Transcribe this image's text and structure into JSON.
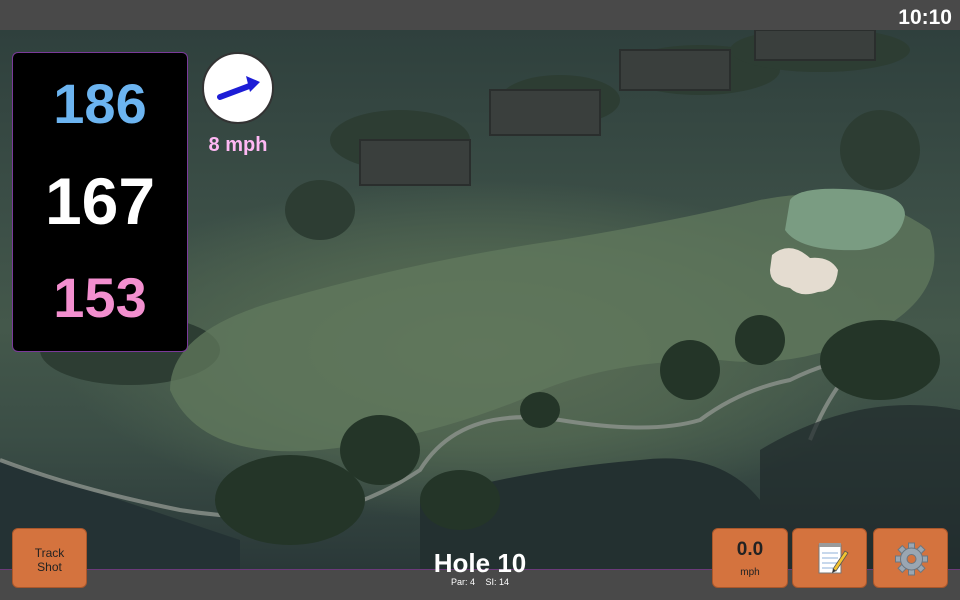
{
  "status": {
    "time": "10:10"
  },
  "distances": {
    "back": "186",
    "middle": "167",
    "front": "153"
  },
  "wind": {
    "speed": "8 mph",
    "icon": "arrow-icon"
  },
  "track_shot": {
    "line1": "Track",
    "line2": "Shot"
  },
  "speedometer": {
    "value": "0.0",
    "unit": "mph"
  },
  "hole": {
    "title": "Hole 10",
    "par": "Par: 4",
    "stroke_index": "SI: 14"
  },
  "toolbar": {
    "notes_icon": "notepad-icon",
    "settings_icon": "gear-icon"
  },
  "colors": {
    "back": "#6cb4f0",
    "middle": "#ffffff",
    "front": "#f38fcf",
    "button": "#d4733e",
    "wind_text": "#ffb8f4"
  }
}
